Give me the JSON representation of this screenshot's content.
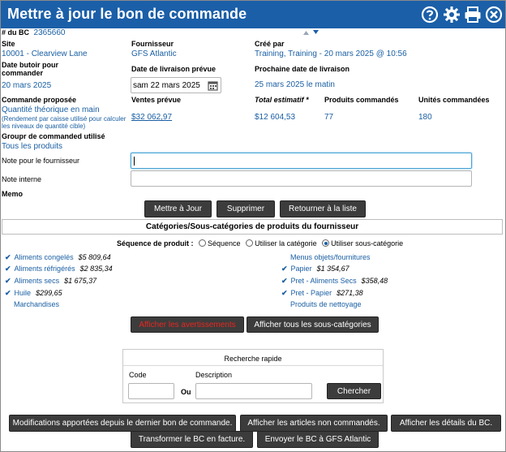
{
  "title": "Mettre à jour le bon de commande",
  "header_icons": [
    "help-icon",
    "gear-icon",
    "printer-icon",
    "close-icon"
  ],
  "bc": {
    "label": "# du BC",
    "number": "2365660"
  },
  "site": {
    "label": "Site",
    "value": "10001 - Clearview Lane"
  },
  "supplier": {
    "label": "Fournisseur",
    "value": "GFS Atlantic"
  },
  "created_by": {
    "label": "Créé par",
    "value": "Training, Training - 20 mars 2025 @ 10:56"
  },
  "order_deadline": {
    "label": "Date butoir pour commander",
    "value": "20 mars 2025"
  },
  "delivery_date": {
    "label": "Date de livraison prévue",
    "value": "sam 22 mars 2025"
  },
  "next_delivery": {
    "label": "Prochaine date de livraison",
    "value": "25 mars 2025 le matin"
  },
  "proposed_order": {
    "label": "Commande proposée",
    "value": "Quantité théorique en main",
    "note": "(Rendement par caisse utilisé pour calculer les niveaux de quantité cible)"
  },
  "forecast_sales": {
    "label": "Ventes prévue",
    "value": "$32 062,97"
  },
  "estimated_total": {
    "label": "Total estimatif *",
    "value": "$12 604,53"
  },
  "products_ordered": {
    "label": "Produits commandés",
    "value": "77"
  },
  "units_ordered": {
    "label": "Unités commandées",
    "value": "180"
  },
  "order_group": {
    "label": "Groupr de commanded utilisé",
    "value": "Tous les produits"
  },
  "supplier_note": {
    "label": "Note pour le fournisseur",
    "value": ""
  },
  "internal_note": {
    "label": "Note interne",
    "value": ""
  },
  "memo": {
    "label": "Memo"
  },
  "actions": {
    "update": "Mettre à Jour",
    "delete": "Supprimer",
    "back": "Retourner à la liste"
  },
  "categories_title": "Catégories/Sous-catégories de produits du fournisseur",
  "sequence": {
    "label": "Séquence de produit :",
    "options": [
      "Séquence",
      "Utiliser la catégorie",
      "Utiliser sous-catégorie"
    ],
    "selected": 2
  },
  "categories_left": [
    {
      "name": "Aliments congelés",
      "amount": "$5 809,64",
      "checked": true
    },
    {
      "name": "Aliments réfrigérés",
      "amount": "$2 835,34",
      "checked": true
    },
    {
      "name": "Aliments secs",
      "amount": "$1 675,37",
      "checked": true
    },
    {
      "name": "Huile",
      "amount": "$299,65",
      "checked": true
    },
    {
      "name": "Marchandises",
      "amount": "",
      "checked": false
    }
  ],
  "categories_right": [
    {
      "name": "Menus objets/fournitures",
      "amount": "",
      "checked": false
    },
    {
      "name": "Papier",
      "amount": "$1 354,67",
      "checked": true
    },
    {
      "name": "Pret - Aliments Secs",
      "amount": "$358,48",
      "checked": true
    },
    {
      "name": "Pret - Papier",
      "amount": "$271,38",
      "checked": true
    },
    {
      "name": "Produits de nettoyage",
      "amount": "",
      "checked": false
    }
  ],
  "show_alerts": "Afficher les avertissements",
  "show_all_sub": "Afficher tous les sous-catégories",
  "quick_search": {
    "title": "Recherche rapide",
    "code_label": "Code",
    "or_label": "Ou",
    "desc_label": "Description",
    "search_button": "Chercher"
  },
  "footer": {
    "changes": "Modifications apportées depuis le dernier bon de commande.",
    "not_ordered": "Afficher les articles non commandés.",
    "details": "Afficher les détails du BC.",
    "invoice": "Transformer le BC en facture.",
    "send": "Envoyer le BC à GFS Atlantic"
  },
  "colors": {
    "header": "#1b5fa8",
    "link": "#1a5fa3",
    "button": "#3c3c3c",
    "alert_text": "#e8271f"
  }
}
